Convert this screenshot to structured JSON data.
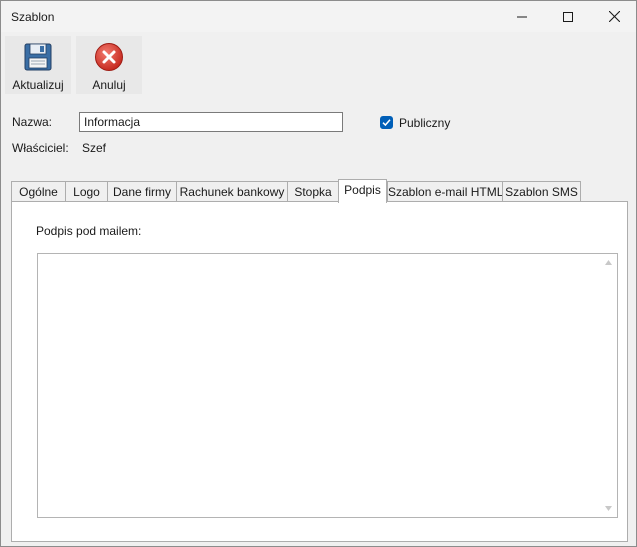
{
  "window": {
    "title": "Szablon"
  },
  "toolbar": {
    "update_label": "Aktualizuj",
    "cancel_label": "Anuluj",
    "update_icon": "save-floppy-icon",
    "cancel_icon": "cancel-x-icon"
  },
  "form": {
    "name_label": "Nazwa:",
    "name_value": "Informacja",
    "owner_label": "Właściciel:",
    "owner_value": "Szef",
    "public_label": "Publiczny",
    "public_checked": true
  },
  "tabs": [
    {
      "label": "Ogólne",
      "active": false
    },
    {
      "label": "Logo",
      "active": false
    },
    {
      "label": "Dane firmy",
      "active": false
    },
    {
      "label": "Rachunek bankowy",
      "active": false
    },
    {
      "label": "Stopka",
      "active": false
    },
    {
      "label": "Podpis",
      "active": true
    },
    {
      "label": "Szablon e-mail HTML",
      "active": false
    },
    {
      "label": "Szablon SMS",
      "active": false
    }
  ],
  "signature": {
    "label": "Podpis pod mailem:",
    "value": ""
  },
  "colors": {
    "accent": "#005fb8",
    "cancel_red": "#d9342b",
    "floppy_blue": "#3a6ea5"
  }
}
